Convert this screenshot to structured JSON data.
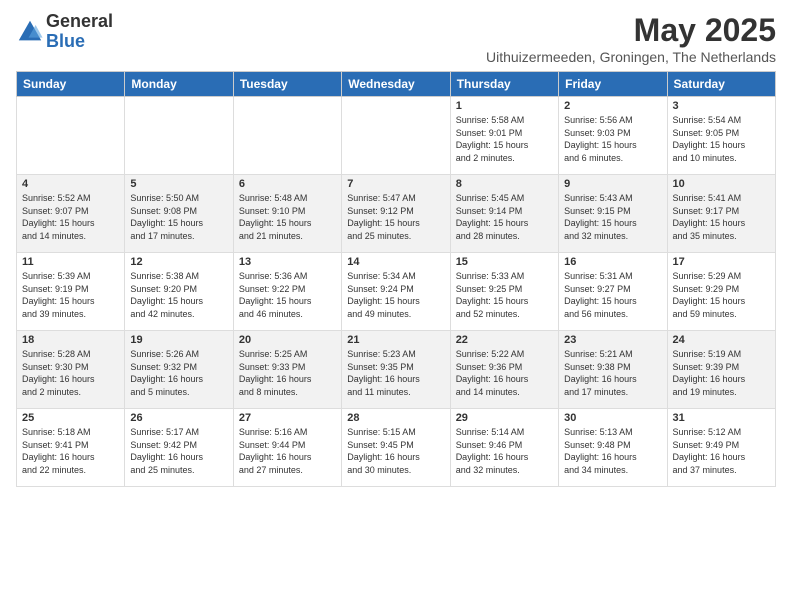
{
  "logo": {
    "general": "General",
    "blue": "Blue"
  },
  "header": {
    "title": "May 2025",
    "subtitle": "Uithuizermeeden, Groningen, The Netherlands"
  },
  "weekdays": [
    "Sunday",
    "Monday",
    "Tuesday",
    "Wednesday",
    "Thursday",
    "Friday",
    "Saturday"
  ],
  "weeks": [
    [
      {
        "day": "",
        "info": ""
      },
      {
        "day": "",
        "info": ""
      },
      {
        "day": "",
        "info": ""
      },
      {
        "day": "",
        "info": ""
      },
      {
        "day": "1",
        "info": "Sunrise: 5:58 AM\nSunset: 9:01 PM\nDaylight: 15 hours\nand 2 minutes."
      },
      {
        "day": "2",
        "info": "Sunrise: 5:56 AM\nSunset: 9:03 PM\nDaylight: 15 hours\nand 6 minutes."
      },
      {
        "day": "3",
        "info": "Sunrise: 5:54 AM\nSunset: 9:05 PM\nDaylight: 15 hours\nand 10 minutes."
      }
    ],
    [
      {
        "day": "4",
        "info": "Sunrise: 5:52 AM\nSunset: 9:07 PM\nDaylight: 15 hours\nand 14 minutes."
      },
      {
        "day": "5",
        "info": "Sunrise: 5:50 AM\nSunset: 9:08 PM\nDaylight: 15 hours\nand 17 minutes."
      },
      {
        "day": "6",
        "info": "Sunrise: 5:48 AM\nSunset: 9:10 PM\nDaylight: 15 hours\nand 21 minutes."
      },
      {
        "day": "7",
        "info": "Sunrise: 5:47 AM\nSunset: 9:12 PM\nDaylight: 15 hours\nand 25 minutes."
      },
      {
        "day": "8",
        "info": "Sunrise: 5:45 AM\nSunset: 9:14 PM\nDaylight: 15 hours\nand 28 minutes."
      },
      {
        "day": "9",
        "info": "Sunrise: 5:43 AM\nSunset: 9:15 PM\nDaylight: 15 hours\nand 32 minutes."
      },
      {
        "day": "10",
        "info": "Sunrise: 5:41 AM\nSunset: 9:17 PM\nDaylight: 15 hours\nand 35 minutes."
      }
    ],
    [
      {
        "day": "11",
        "info": "Sunrise: 5:39 AM\nSunset: 9:19 PM\nDaylight: 15 hours\nand 39 minutes."
      },
      {
        "day": "12",
        "info": "Sunrise: 5:38 AM\nSunset: 9:20 PM\nDaylight: 15 hours\nand 42 minutes."
      },
      {
        "day": "13",
        "info": "Sunrise: 5:36 AM\nSunset: 9:22 PM\nDaylight: 15 hours\nand 46 minutes."
      },
      {
        "day": "14",
        "info": "Sunrise: 5:34 AM\nSunset: 9:24 PM\nDaylight: 15 hours\nand 49 minutes."
      },
      {
        "day": "15",
        "info": "Sunrise: 5:33 AM\nSunset: 9:25 PM\nDaylight: 15 hours\nand 52 minutes."
      },
      {
        "day": "16",
        "info": "Sunrise: 5:31 AM\nSunset: 9:27 PM\nDaylight: 15 hours\nand 56 minutes."
      },
      {
        "day": "17",
        "info": "Sunrise: 5:29 AM\nSunset: 9:29 PM\nDaylight: 15 hours\nand 59 minutes."
      }
    ],
    [
      {
        "day": "18",
        "info": "Sunrise: 5:28 AM\nSunset: 9:30 PM\nDaylight: 16 hours\nand 2 minutes."
      },
      {
        "day": "19",
        "info": "Sunrise: 5:26 AM\nSunset: 9:32 PM\nDaylight: 16 hours\nand 5 minutes."
      },
      {
        "day": "20",
        "info": "Sunrise: 5:25 AM\nSunset: 9:33 PM\nDaylight: 16 hours\nand 8 minutes."
      },
      {
        "day": "21",
        "info": "Sunrise: 5:23 AM\nSunset: 9:35 PM\nDaylight: 16 hours\nand 11 minutes."
      },
      {
        "day": "22",
        "info": "Sunrise: 5:22 AM\nSunset: 9:36 PM\nDaylight: 16 hours\nand 14 minutes."
      },
      {
        "day": "23",
        "info": "Sunrise: 5:21 AM\nSunset: 9:38 PM\nDaylight: 16 hours\nand 17 minutes."
      },
      {
        "day": "24",
        "info": "Sunrise: 5:19 AM\nSunset: 9:39 PM\nDaylight: 16 hours\nand 19 minutes."
      }
    ],
    [
      {
        "day": "25",
        "info": "Sunrise: 5:18 AM\nSunset: 9:41 PM\nDaylight: 16 hours\nand 22 minutes."
      },
      {
        "day": "26",
        "info": "Sunrise: 5:17 AM\nSunset: 9:42 PM\nDaylight: 16 hours\nand 25 minutes."
      },
      {
        "day": "27",
        "info": "Sunrise: 5:16 AM\nSunset: 9:44 PM\nDaylight: 16 hours\nand 27 minutes."
      },
      {
        "day": "28",
        "info": "Sunrise: 5:15 AM\nSunset: 9:45 PM\nDaylight: 16 hours\nand 30 minutes."
      },
      {
        "day": "29",
        "info": "Sunrise: 5:14 AM\nSunset: 9:46 PM\nDaylight: 16 hours\nand 32 minutes."
      },
      {
        "day": "30",
        "info": "Sunrise: 5:13 AM\nSunset: 9:48 PM\nDaylight: 16 hours\nand 34 minutes."
      },
      {
        "day": "31",
        "info": "Sunrise: 5:12 AM\nSunset: 9:49 PM\nDaylight: 16 hours\nand 37 minutes."
      }
    ]
  ]
}
